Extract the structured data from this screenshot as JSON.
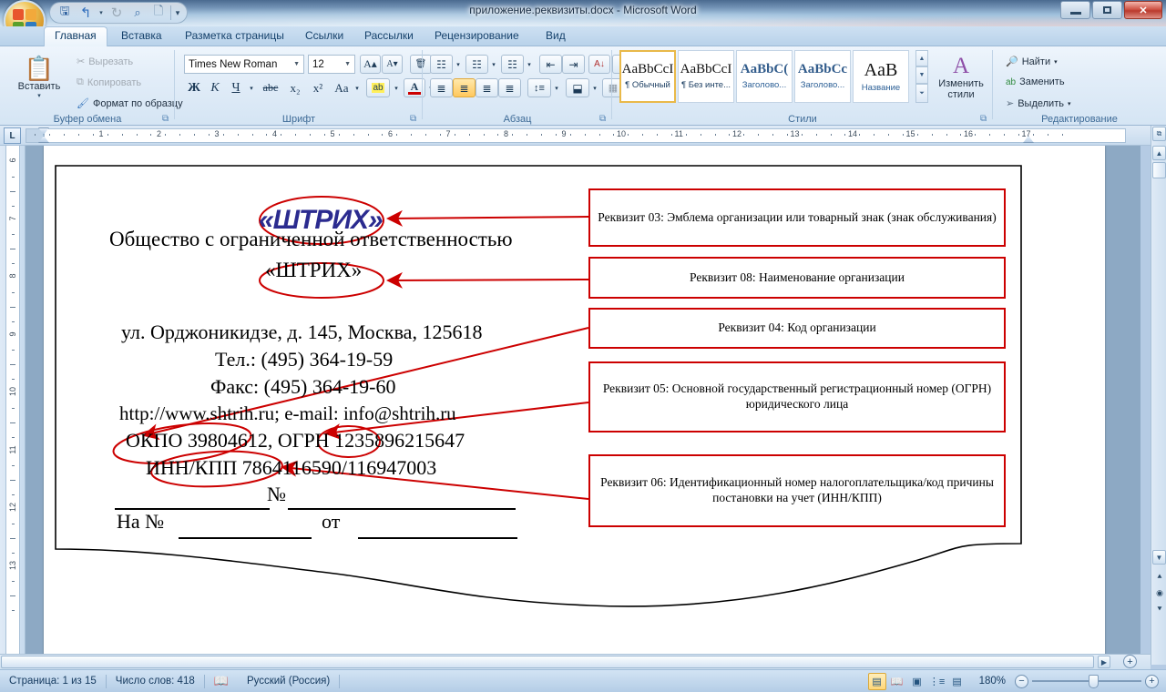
{
  "window": {
    "title": "приложение.реквизиты.docx - Microsoft Word",
    "minimize_label": "—",
    "restore_label": "❐",
    "close_label": "✕"
  },
  "quick_access": {
    "office_button": "office-orb",
    "buttons": [
      {
        "name": "save",
        "glyph": "💾"
      },
      {
        "name": "undo",
        "glyph": "↰"
      },
      {
        "name": "redo",
        "glyph": "↻"
      },
      {
        "name": "print-preview",
        "glyph": "🔍"
      },
      {
        "name": "new",
        "glyph": "🗋"
      }
    ],
    "customize_glyph": "▾"
  },
  "ribbon": {
    "tabs": [
      {
        "label": "Главная",
        "active": true
      },
      {
        "label": "Вставка",
        "active": false
      },
      {
        "label": "Разметка страницы",
        "active": false
      },
      {
        "label": "Ссылки",
        "active": false
      },
      {
        "label": "Рассылки",
        "active": false
      },
      {
        "label": "Рецензирование",
        "active": false
      },
      {
        "label": "Вид",
        "active": false
      }
    ],
    "groups": {
      "clipboard": {
        "label": "Буфер обмена",
        "paste": "Вставить",
        "cut": "Вырезать",
        "copy": "Копировать",
        "format_painter": "Формат по образцу"
      },
      "font": {
        "label": "Шрифт",
        "font_name": "Times New Roman",
        "font_size": "12",
        "grow": "A",
        "shrink": "A",
        "clear_format": "Aa",
        "bold": "Ж",
        "italic": "К",
        "underline": "Ч",
        "strike": "abc",
        "subscript": "x₂",
        "superscript": "x²",
        "change_case": "Aa",
        "highlight": "ab",
        "font_color": "A"
      },
      "paragraph": {
        "label": "Абзац",
        "bullets": "☰",
        "numbering": "☰",
        "multilevel": "☰",
        "decrease_indent": "⇤",
        "increase_indent": "⇥",
        "sort": "A↓",
        "show_marks": "¶",
        "align_left": "≡",
        "align_center": "≡",
        "align_right": "≡",
        "justify": "≡",
        "line_spacing": "↕",
        "shading": "▨",
        "borders": "⊞"
      },
      "styles": {
        "label": "Стили",
        "change_styles": "Изменить стили",
        "items": [
          {
            "sample": "AaBbCcI",
            "name": "¶ Обычный",
            "selected": true,
            "kind": "normal"
          },
          {
            "sample": "AaBbCcI",
            "name": "¶ Без инте...",
            "selected": false,
            "kind": "normal"
          },
          {
            "sample": "AaBbC(",
            "name": "Заголово...",
            "selected": false,
            "kind": "heading"
          },
          {
            "sample": "AaBbCc",
            "name": "Заголово...",
            "selected": false,
            "kind": "heading"
          },
          {
            "sample": "AaB",
            "name": "Название",
            "selected": false,
            "kind": "title"
          }
        ]
      },
      "editing": {
        "label": "Редактирование",
        "find": "Найти",
        "replace": "Заменить",
        "select": "Выделить"
      }
    }
  },
  "ruler": {
    "horizontal_numbers": [
      "1",
      "2",
      "3",
      "4",
      "5",
      "6",
      "7",
      "8",
      "9",
      "10",
      "11",
      "12",
      "13",
      "14",
      "15",
      "16",
      "17"
    ],
    "vertical_numbers": [
      "6",
      "7",
      "8",
      "9",
      "10",
      "11",
      "12",
      "13"
    ],
    "tab_stop_glyph": "L"
  },
  "document": {
    "logo": "«ШТРИХ»",
    "lines": [
      "Общество с ограниченной ответственностью",
      "«ШТРИХ»",
      "ул. Орджоникидзе, д. 145, Москва, 125618",
      "Тел.: (495) 364-19-59",
      "Факс:  (495) 364-19-60",
      "http://www.shtrih.ru; e-mail: info@shtrih.ru",
      "ОКПО 39804612, ОГРН 1235896215647",
      "ИНН/КПП 7864116590/116947003"
    ],
    "number_label": "№",
    "reply_prefix": "На №",
    "reply_from": "от",
    "callouts": [
      {
        "id": "03",
        "text": "Реквизит 03: Эмблема организации или товарный знак (знак обслуживания)"
      },
      {
        "id": "08",
        "text": "Реквизит 08: Наименование организации"
      },
      {
        "id": "04",
        "text": "Реквизит 04: Код организации"
      },
      {
        "id": "05",
        "text": "Реквизит 05: Основной государственный регистрационный номер (ОГРН) юридического лица"
      },
      {
        "id": "06",
        "text": "Реквизит 06: Идентификационный номер налогоплательщика/код причины постановки на учет (ИНН/КПП)"
      }
    ]
  },
  "status": {
    "page": "Страница: 1 из 15",
    "words": "Число слов: 418",
    "language": "Русский (Россия)",
    "zoom": "180%",
    "zoom_out": "−",
    "zoom_in": "+",
    "views": [
      {
        "name": "print-layout",
        "glyph": "▤",
        "active": true
      },
      {
        "name": "full-screen-reading",
        "glyph": "📖",
        "active": false
      },
      {
        "name": "web-layout",
        "glyph": "▣",
        "active": false
      },
      {
        "name": "outline",
        "glyph": "⋮≡",
        "active": false
      },
      {
        "name": "draft",
        "glyph": "▤",
        "active": false
      }
    ]
  },
  "colors": {
    "accent_red": "#cc0000",
    "logo_blue": "#2b2b8f",
    "ribbon_blue": "#15416b"
  }
}
